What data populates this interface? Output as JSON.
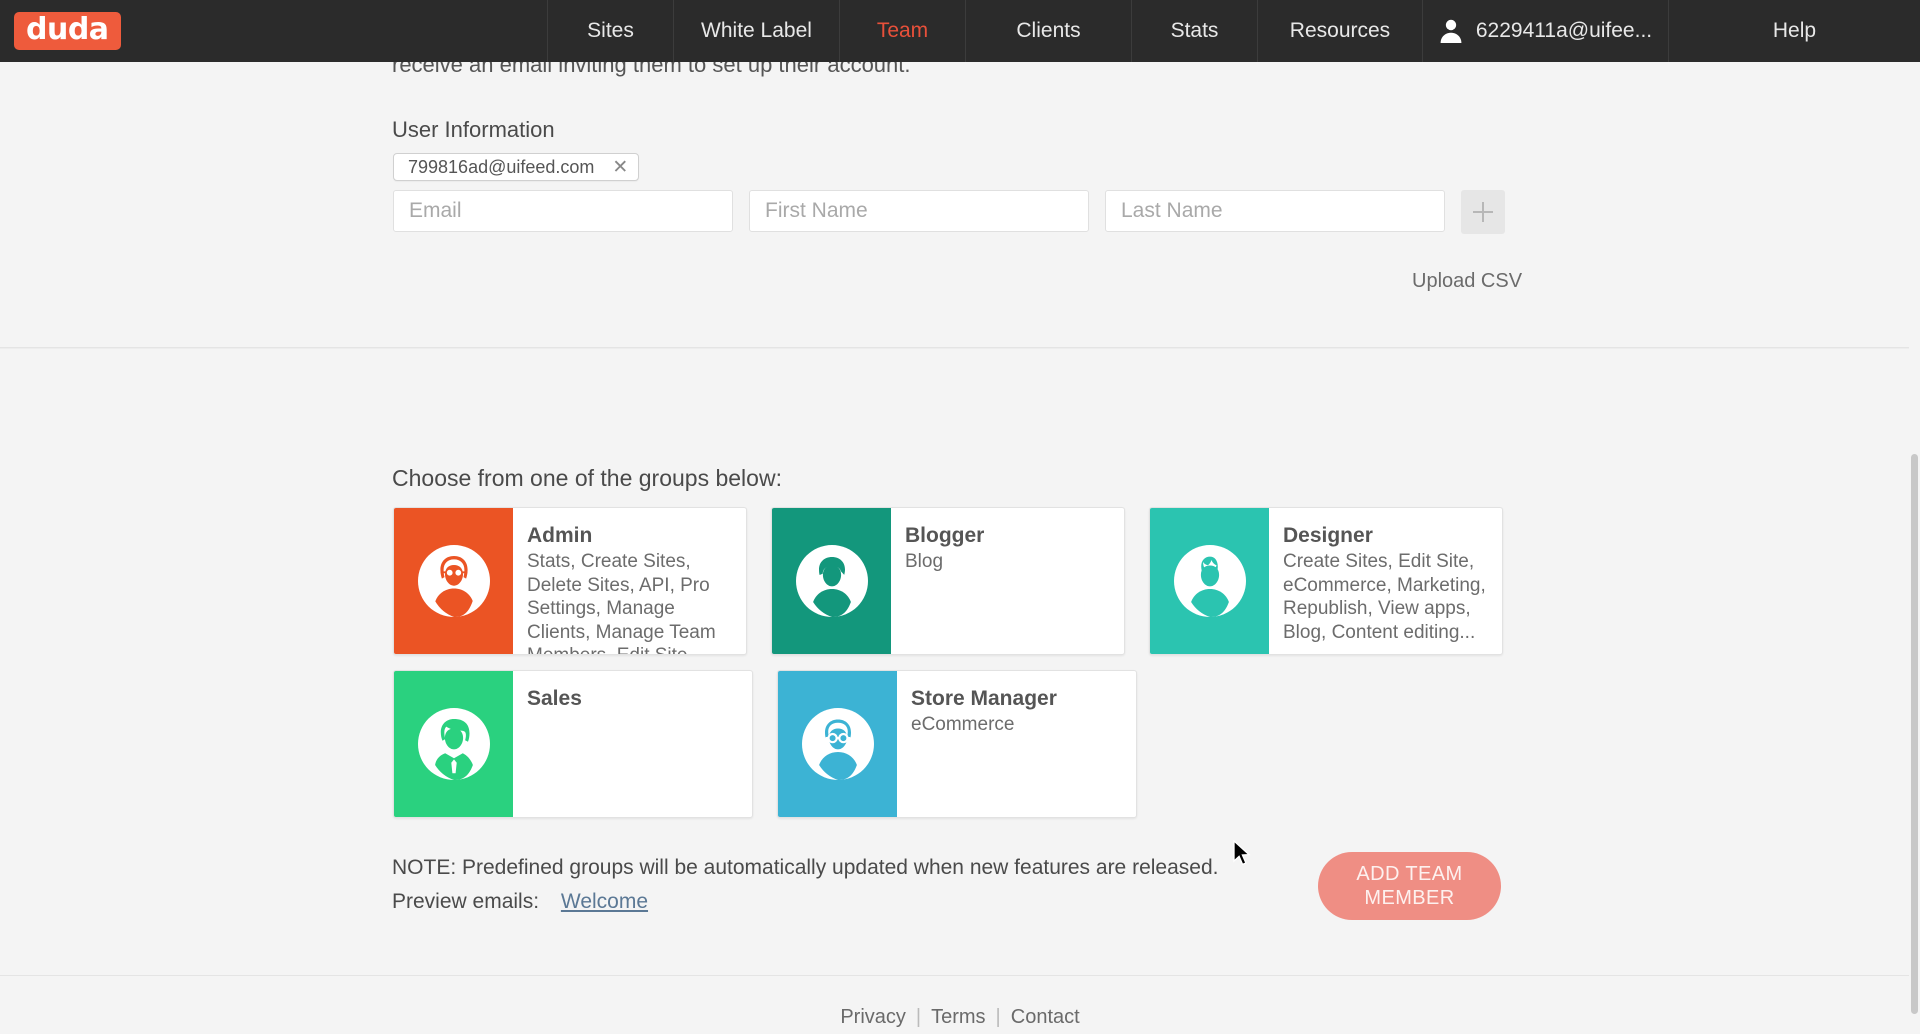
{
  "topnav": {
    "logo_text": "duda",
    "items": [
      {
        "label": "Sites",
        "active": false
      },
      {
        "label": "White Label",
        "active": false
      },
      {
        "label": "Team",
        "active": true
      },
      {
        "label": "Clients",
        "active": false
      },
      {
        "label": "Stats",
        "active": false
      },
      {
        "label": "Resources",
        "active": false
      }
    ],
    "user_email": "6229411a@uifee...",
    "help_label": "Help",
    "active_color": "#e8503a",
    "bar_color": "#2b2b2b",
    "logo_color": "#ee5b3c"
  },
  "invite": {
    "intro_cut_text": "receive an email inviting them to set up their account.",
    "section_label": "User Information",
    "chip": {
      "email": "799816ad@uifeed.com",
      "remove_icon": "✕"
    },
    "fields": {
      "email_placeholder": "Email",
      "email_value": "",
      "first_name_placeholder": "First Name",
      "first_name_value": "",
      "last_name_placeholder": "Last Name",
      "last_name_value": ""
    },
    "add_row_icon": "plus-icon",
    "upload_csv_label": "Upload CSV"
  },
  "groups": {
    "title": "Choose from one of the groups below:",
    "cards": [
      {
        "name": "Admin",
        "desc": "Stats, Create Sites, Delete Sites, API, Pro Settings, Manage Clients, Manage Team Members, Edit Site...",
        "color": "#eb5424",
        "icon": "avatar-glasses-long-hair-icon"
      },
      {
        "name": "Blogger",
        "desc": "Blog",
        "color": "#13977c",
        "icon": "avatar-short-hair-icon"
      },
      {
        "name": "Designer",
        "desc": "Create Sites, Edit Site, eCommerce, Marketing, Republish, View apps, Blog, Content editing...",
        "color": "#2bc4b0",
        "icon": "avatar-spiky-hair-icon"
      },
      {
        "name": "Sales",
        "desc": "",
        "color": "#2ad17f",
        "icon": "avatar-suit-tie-icon"
      },
      {
        "name": "Store Manager",
        "desc": "eCommerce",
        "color": "#3cb3d4",
        "icon": "avatar-glasses-icon"
      }
    ]
  },
  "footer_area": {
    "note": "NOTE: Predefined groups will be automatically updated when new features are released.",
    "preview_label": "Preview emails:",
    "welcome_link": "Welcome",
    "add_button": "ADD TEAM MEMBER",
    "add_button_color": "#ef8e84"
  },
  "footer": {
    "links": [
      "Privacy",
      "Terms",
      "Contact"
    ],
    "separator": "|"
  }
}
